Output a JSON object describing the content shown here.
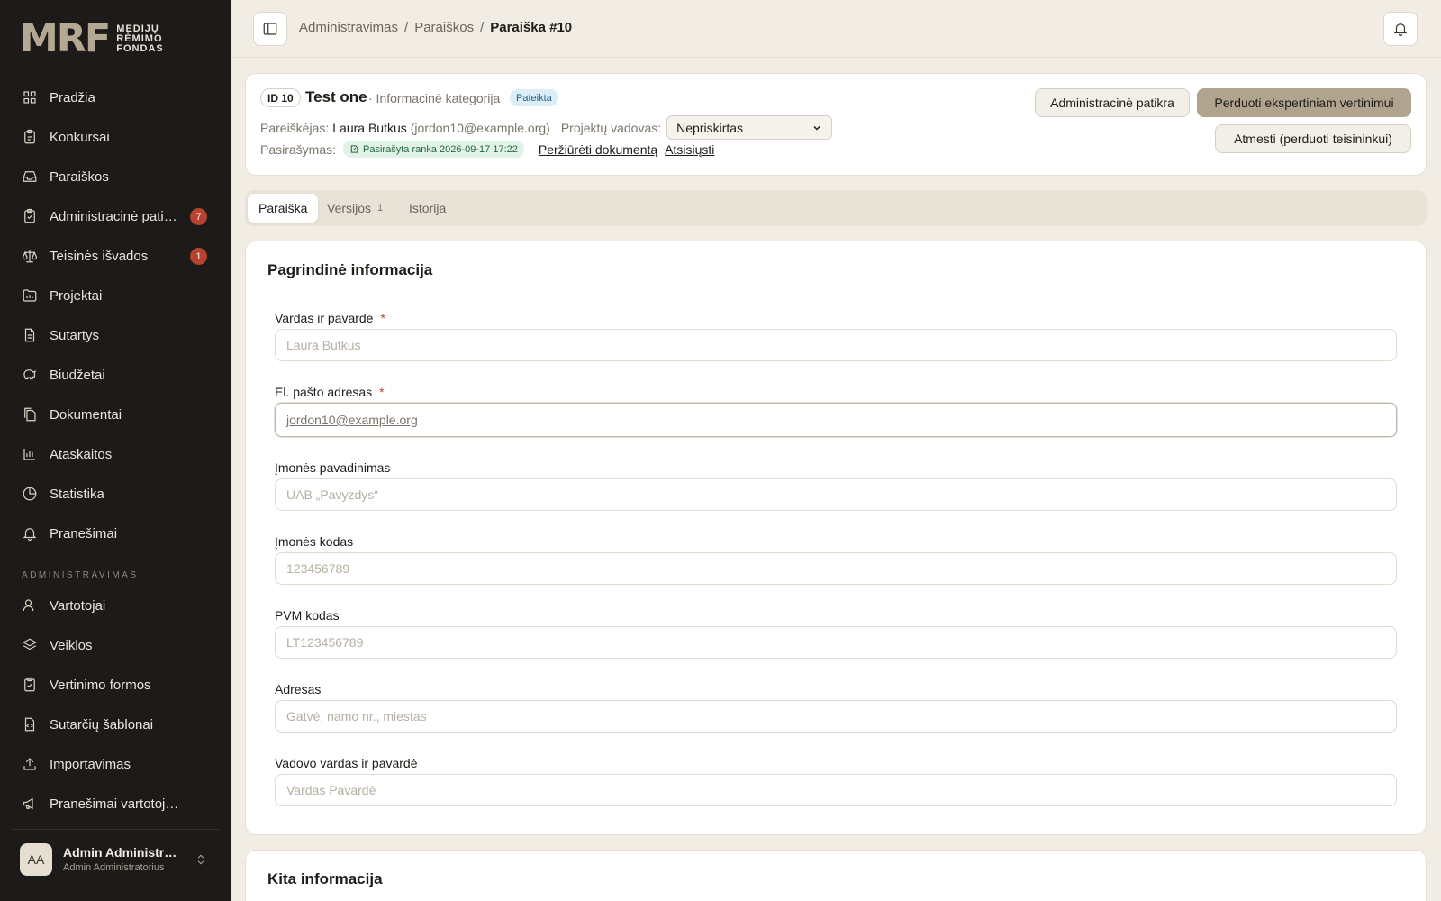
{
  "brand": {
    "mark": "MRF",
    "line1": "MEDIJŲ",
    "line2": "RĖMIMO",
    "line3": "FONDAS"
  },
  "sidebar": {
    "items": [
      {
        "label": "Pradžia",
        "icon": "grid-icon"
      },
      {
        "label": "Konkursai",
        "icon": "clipboard-icon"
      },
      {
        "label": "Paraiškos",
        "icon": "inbox-icon"
      },
      {
        "label": "Administracinė patikra",
        "icon": "clipboard-check-icon",
        "badge": "7"
      },
      {
        "label": "Teisinės išvados",
        "icon": "scale-icon",
        "badge": "1"
      },
      {
        "label": "Projektai",
        "icon": "folder-chart-icon"
      },
      {
        "label": "Sutartys",
        "icon": "file-text-icon"
      },
      {
        "label": "Biudžetai",
        "icon": "piggy-bank-icon"
      },
      {
        "label": "Dokumentai",
        "icon": "files-icon"
      },
      {
        "label": "Ataskaitos",
        "icon": "bar-chart-icon"
      },
      {
        "label": "Statistika",
        "icon": "pie-chart-icon"
      },
      {
        "label": "Pranešimai",
        "icon": "bell-icon"
      }
    ],
    "admin_section": "ADMINISTRAVIMAS",
    "admin_items": [
      {
        "label": "Vartotojai",
        "icon": "users-icon"
      },
      {
        "label": "Veiklos",
        "icon": "layers-icon"
      },
      {
        "label": "Vertinimo formos",
        "icon": "clipboard-check-icon"
      },
      {
        "label": "Sutarčių šablonai",
        "icon": "file-code-icon"
      },
      {
        "label": "Importavimas",
        "icon": "upload-icon"
      },
      {
        "label": "Pranešimai vartotojams",
        "icon": "megaphone-icon"
      }
    ],
    "user": {
      "initials": "AA",
      "name": "Admin Administratorius",
      "role": "Admin Administratorius"
    }
  },
  "breadcrumb": {
    "items": [
      "Administravimas",
      "Paraiškos"
    ],
    "separator": "/",
    "current": "Paraiška #10"
  },
  "application": {
    "id_label": "ID 10",
    "title": "Test one",
    "category": "· Informacinė kategorija",
    "status": "Pateikta",
    "applicant_label": "Pareiškėjas:",
    "applicant_name": "Laura Butkus",
    "applicant_email": "(jordon10@example.org)",
    "manager_label": "Projektų vadovas:",
    "manager_value": "Nepriskirtas",
    "signing_label": "Pasirašymas:",
    "signing_status": "Pasirašyta ranka 2026-09-17 17:22",
    "view_document": "Peržiūrėti dokumentą",
    "download": "Atsisiųsti",
    "btn_admin_check": "Administracinė patikra",
    "btn_forward": "Perduoti ekspertiniam vertinimui",
    "btn_reject": "Atmesti (perduoti teisininkui)"
  },
  "tabs": [
    {
      "label": "Paraiška",
      "active": true
    },
    {
      "label": "Versijos",
      "count": "1"
    },
    {
      "label": "Istorija"
    }
  ],
  "form": {
    "section_title": "Pagrindinė informacija",
    "fields": [
      {
        "label": "Vardas ir pavardė",
        "required": true,
        "placeholder": "Laura Butkus"
      },
      {
        "label": "El. pašto adresas",
        "required": true,
        "value": "jordon10@example.org"
      },
      {
        "label": "Įmonės pavadinimas",
        "placeholder": "UAB „Pavyzdys“"
      },
      {
        "label": "Įmonės kodas",
        "placeholder": "123456789"
      },
      {
        "label": "PVM kodas",
        "placeholder": "LT123456789"
      },
      {
        "label": "Adresas",
        "placeholder": "Gatvė, namo nr., miestas"
      },
      {
        "label": "Vadovo vardas ir pavardė",
        "placeholder": "Vardas Pavardė"
      }
    ],
    "next_section_title": "Kita informacija"
  }
}
